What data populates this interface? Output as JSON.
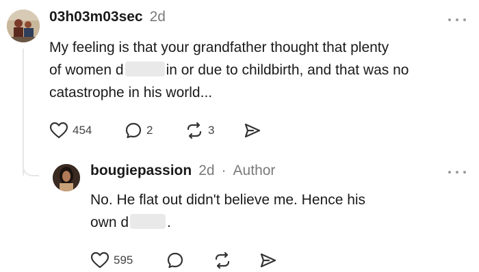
{
  "comment": {
    "username": "03h03m03sec",
    "time": "2d",
    "text_line1": "My feeling is that your grandfather thought that plenty",
    "text_line2_pre": "of women d",
    "text_line2_post": "in or due to childbirth, and that was no",
    "text_line3": "catastrophe in his world...",
    "likes": "454",
    "replies": "2",
    "reposts": "3",
    "icons": [
      "heart-icon",
      "comment-icon",
      "repost-icon",
      "share-icon",
      "more-icon"
    ]
  },
  "reply": {
    "username": "bougiepassion",
    "time": "2d",
    "separator": "·",
    "role": "Author",
    "text_line1": "No. He flat out didn't believe me. Hence his",
    "text_line2_pre": "own d",
    "text_line2_post": ".",
    "likes": "595",
    "icons": [
      "heart-icon",
      "comment-icon",
      "repost-icon",
      "share-icon",
      "more-icon"
    ]
  },
  "colors": {
    "text": "#1a1a1a",
    "muted": "#7a7a7a",
    "line": "#e6e6e6",
    "redaction": "#e9e9e9"
  }
}
